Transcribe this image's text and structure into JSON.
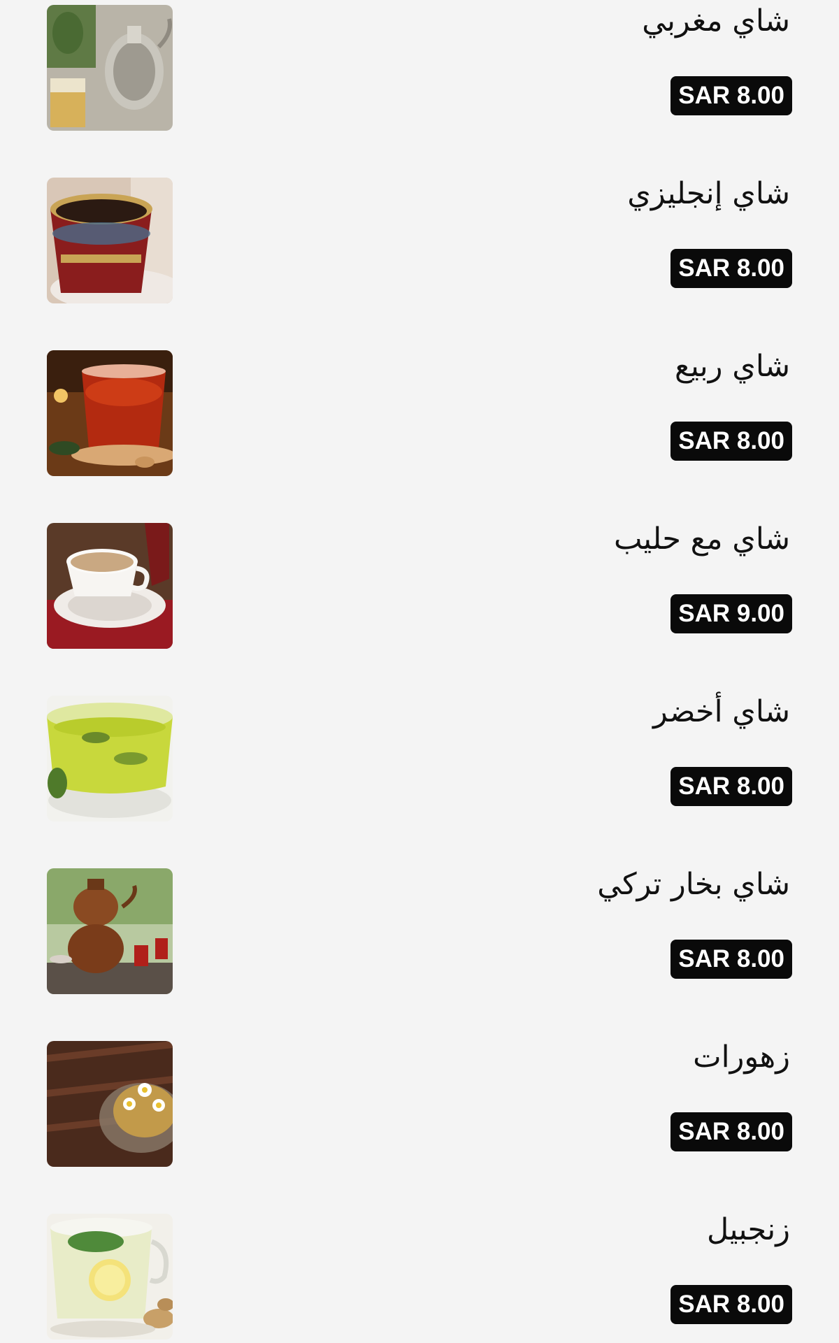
{
  "menu": {
    "items": [
      {
        "name": "شاي مغربي",
        "price": "SAR 8.00",
        "image": "moroccan-tea-photo"
      },
      {
        "name": "شاي إنجليزي",
        "price": "SAR 8.00",
        "image": "english-tea-photo"
      },
      {
        "name": "شاي ربيع",
        "price": "SAR 8.00",
        "image": "rabea-tea-photo"
      },
      {
        "name": "شاي مع حليب",
        "price": "SAR 9.00",
        "image": "milk-tea-photo"
      },
      {
        "name": "شاي أخضر",
        "price": "SAR 8.00",
        "image": "green-tea-photo"
      },
      {
        "name": "شاي بخار تركي",
        "price": "SAR 8.00",
        "image": "turkish-tea-photo"
      },
      {
        "name": "زهورات",
        "price": "SAR 8.00",
        "image": "herbal-tea-photo"
      },
      {
        "name": "زنجبيل",
        "price": "SAR 8.00",
        "image": "ginger-tea-photo"
      }
    ]
  }
}
